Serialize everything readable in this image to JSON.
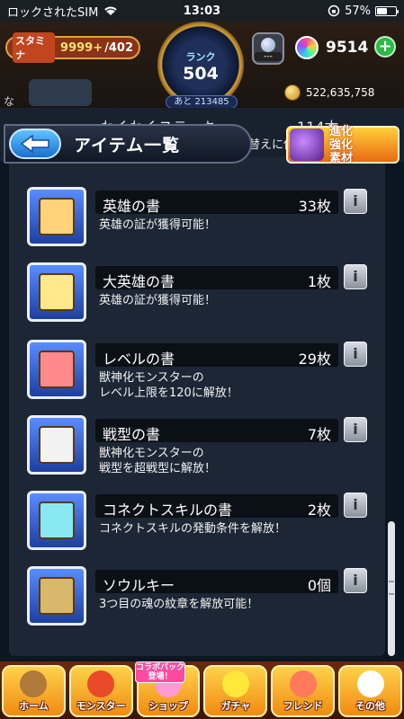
{
  "status_bar": {
    "carrier": "ロックされたSIM",
    "time": "13:03",
    "battery": "57%",
    "battery_level": 0.57
  },
  "header": {
    "stamina_label": "スタミナ",
    "stamina_value": "9999+",
    "stamina_max": "/402",
    "rank_label": "ランク",
    "rank_value": "504",
    "next_exp": "あと 213485",
    "egg_value": "---",
    "orb_count": "9514",
    "orb_plus": "+",
    "gold": "522,635,758"
  },
  "behind": {
    "fragment": "な",
    "item_title": "わくわくステッキ",
    "item_sub": "の付替えに使用！",
    "item_count": "114本"
  },
  "title_bar": {
    "title": "アイテム一覧",
    "evolve_badge": "進化\n強化\n素材"
  },
  "items": [
    {
      "name": "英雄の書",
      "count": "33枚",
      "desc": "英雄の証が獲得可能！",
      "color": "#ffd27a"
    },
    {
      "name": "大英雄の書",
      "count": "1枚",
      "desc": "英雄の証が獲得可能！",
      "color": "#ffe98a"
    },
    {
      "name": "レベルの書",
      "count": "29枚",
      "desc": "獣神化モンスターの\nレベル上限を120に解放！",
      "color": "#ff8a8a"
    },
    {
      "name": "戦型の書",
      "count": "7枚",
      "desc": "獣神化モンスターの\n戦型を超戦型に解放！",
      "color": "#f2f2f2"
    },
    {
      "name": "コネクトスキルの書",
      "count": "2枚",
      "desc": "コネクトスキルの発動条件を解放！",
      "color": "#8ae8f2"
    },
    {
      "name": "ソウルキー",
      "count": "0個",
      "desc": "3つ目の魂の紋章を解放可能！",
      "color": "#d8b86a"
    }
  ],
  "info_glyph": "i",
  "nav": {
    "collab": "コラボパック\n登場！",
    "items": [
      {
        "label": "ホーム",
        "color": "#b07a3a"
      },
      {
        "label": "モンスター",
        "color": "#e84a2a"
      },
      {
        "label": "ショップ",
        "color": "#ff9ad2"
      },
      {
        "label": "ガチャ",
        "color": "#ffe83a"
      },
      {
        "label": "フレンド",
        "color": "#ff7a5a"
      },
      {
        "label": "その他",
        "color": "#ffffff"
      }
    ]
  }
}
